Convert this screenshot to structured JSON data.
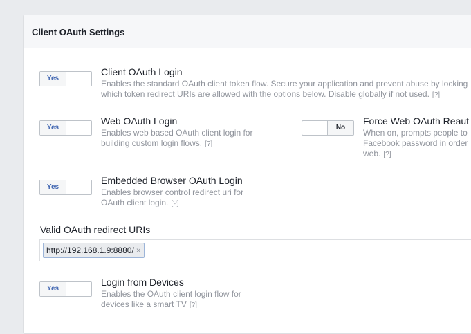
{
  "panel": {
    "title": "Client OAuth Settings"
  },
  "settings": [
    {
      "title": "Client OAuth Login",
      "toggle": "Yes",
      "desc1": "Enables the standard OAuth client token flow. Secure your application and prevent abuse by locking",
      "desc2": "which token redirect URIs are allowed with the options below. Disable globally if not used.",
      "help": "[?]"
    },
    {
      "title": "Web OAuth Login",
      "toggle": "Yes",
      "desc1": "Enables web based OAuth client login for",
      "desc2": "building custom login flows.",
      "help": "[?]"
    },
    {
      "title": "Force Web OAuth Reaut",
      "toggle": "No",
      "desc1": "When on, prompts people to",
      "desc2": "Facebook password in order",
      "desc3": "web.",
      "help": "[?]"
    },
    {
      "title": "Embedded Browser OAuth Login",
      "toggle": "Yes",
      "desc1": "Enables browser control redirect uri for",
      "desc2": "OAuth client login.",
      "help": "[?]"
    },
    {
      "title": "Login from Devices",
      "toggle": "Yes",
      "desc1": "Enables the OAuth client login flow for",
      "desc2": "devices like a smart TV",
      "help": "[?]"
    }
  ],
  "redirect": {
    "label": "Valid OAuth redirect URIs",
    "tokens": [
      "http://192.168.1.9:8880/"
    ],
    "remove_glyph": "×"
  }
}
